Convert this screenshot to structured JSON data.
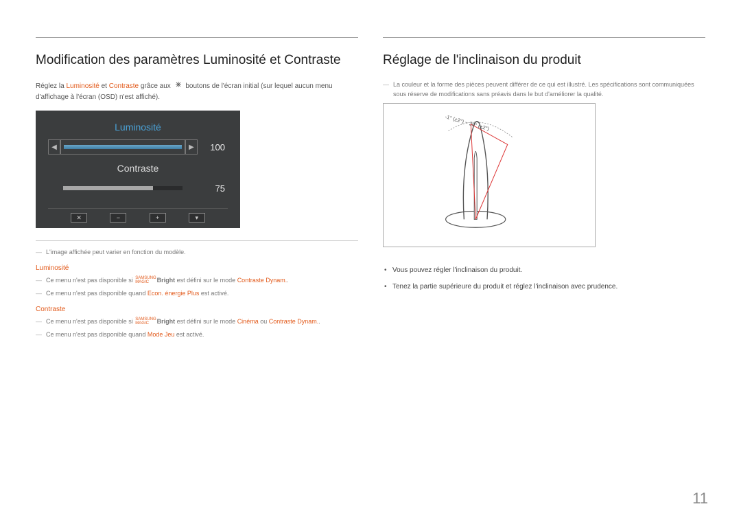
{
  "page_number": "11",
  "left": {
    "title": "Modification des paramètres Luminosité et Contraste",
    "intro_prefix": "Réglez la ",
    "intro_lumin": "Luminosité",
    "intro_and": " et ",
    "intro_cont": "Contraste",
    "intro_mid": " grâce aux ",
    "intro_suffix": " boutons de l'écran initial (sur lequel aucun menu d'affichage à l'écran (OSD) n'est affiché).",
    "osd": {
      "lumin_label": "Luminosité",
      "contrast_label": "Contraste",
      "lumin_value": "100",
      "contrast_value": "75",
      "btn_close": "✕",
      "btn_minus": "−",
      "btn_plus": "+",
      "btn_down": "▾"
    },
    "note_image": "L'image affichée peut varier en fonction du modèle.",
    "section_lumin": "Luminosité",
    "lumin_note1_pre": "Ce menu n'est pas disponible si ",
    "magic_top": "SAMSUNG",
    "magic_bottom": "MAGIC",
    "bright_word": "Bright",
    "lumin_note1_mid": " est défini sur le mode ",
    "lumin_note1_mode": "Contraste Dynam.",
    "lumin_note1_end": ".",
    "lumin_note2_pre": "Ce menu n'est pas disponible quand ",
    "lumin_note2_mode": "Econ. énergie Plus",
    "lumin_note2_end": " est activé.",
    "section_cont": "Contraste",
    "cont_note1_mid": " est défini sur le mode ",
    "cont_note1_mode1": "Cinéma",
    "cont_note1_or": " ou ",
    "cont_note1_mode2": "Contraste Dynam.",
    "cont_note1_end": ".",
    "cont_note2_pre": "Ce menu n'est pas disponible quand ",
    "cont_note2_mode": "Mode Jeu",
    "cont_note2_end": " est activé."
  },
  "right": {
    "title": "Réglage de l'inclinaison du produit",
    "note_spec": "La couleur et la forme des pièces peuvent différer de ce qui est illustré. Les spécifications sont communiquées sous réserve de modifications sans préavis dans le but d'améliorer la qualité.",
    "tilt_range": "-1° (±2°) ~ 20° (±2°)",
    "bullet1": "Vous pouvez régler l'inclinaison du produit.",
    "bullet2": "Tenez la partie supérieure du produit et réglez l'inclinaison avec prudence."
  }
}
